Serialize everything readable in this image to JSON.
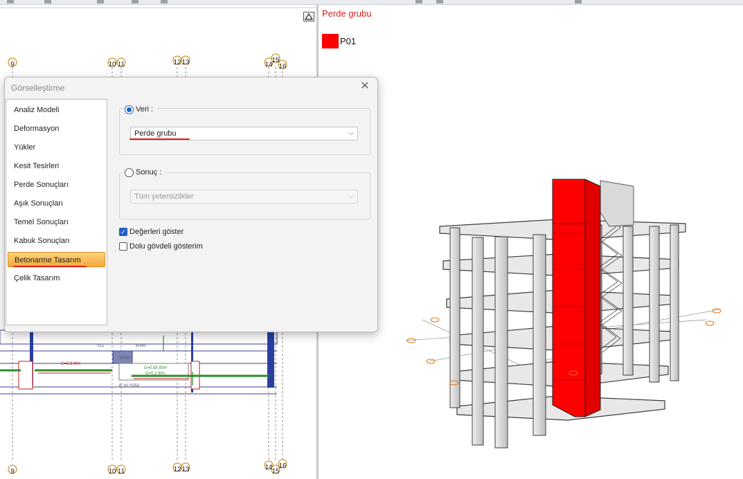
{
  "plan": {
    "axis_labels_top": [
      "9",
      "10",
      "11",
      "12",
      "13",
      "14",
      "15",
      "16"
    ],
    "axis_labels_bottom": [
      "9",
      "10",
      "11",
      "12",
      "13",
      "14",
      "15",
      "16"
    ],
    "annotations": {
      "s11": "S11",
      "beam_size": "80/40",
      "col_size": "30/50",
      "load_a": "G=0.5 tf/m",
      "load_b": "G=0.55 tf/m²",
      "load_c": "G=0.2 tf/m",
      "beam_label": "K 18 25/50"
    }
  },
  "view3d": {
    "legend_title": "Perde grubu",
    "legend_items": [
      {
        "label": "P01",
        "color": "#ff0000"
      }
    ]
  },
  "dialog": {
    "title": "Görselleştirme",
    "close_glyph": "✕",
    "nav_items": [
      {
        "label": "Analiz Modeli",
        "active": false
      },
      {
        "label": "Deformasyon",
        "active": false
      },
      {
        "label": "Yükler",
        "active": false
      },
      {
        "label": "Kesit Tesirleri",
        "active": false
      },
      {
        "label": "Perde Sonuçları",
        "active": false
      },
      {
        "label": "Aşık Sonuçları",
        "active": false
      },
      {
        "label": "Temel Sonuçları",
        "active": false
      },
      {
        "label": "Kabuk Sonuçları",
        "active": false
      },
      {
        "label": "Betonarme Tasarım",
        "active": true
      },
      {
        "label": "Çelik Tasarım",
        "active": false
      }
    ],
    "veri": {
      "label": "Veri :",
      "selected": true,
      "value": "Perde grubu"
    },
    "sonuc": {
      "label": "Sonuç :",
      "selected": false,
      "value": "Tüm yetersizlikler"
    },
    "show_values": {
      "label": "Değerleri göster",
      "checked": true
    },
    "solid_body": {
      "label": "Dolu gövdeli gösterim",
      "checked": false
    }
  },
  "colors": {
    "accent": "#1f63c6",
    "highlight": "#f2a93b",
    "shear_wall": "#ff0000",
    "frame": "#d9d9d9",
    "legend_text": "#d81e1e"
  },
  "icons": {
    "collapse": "triangle-up-icon",
    "close": "close-icon",
    "dropdown": "chevron-down-icon"
  }
}
